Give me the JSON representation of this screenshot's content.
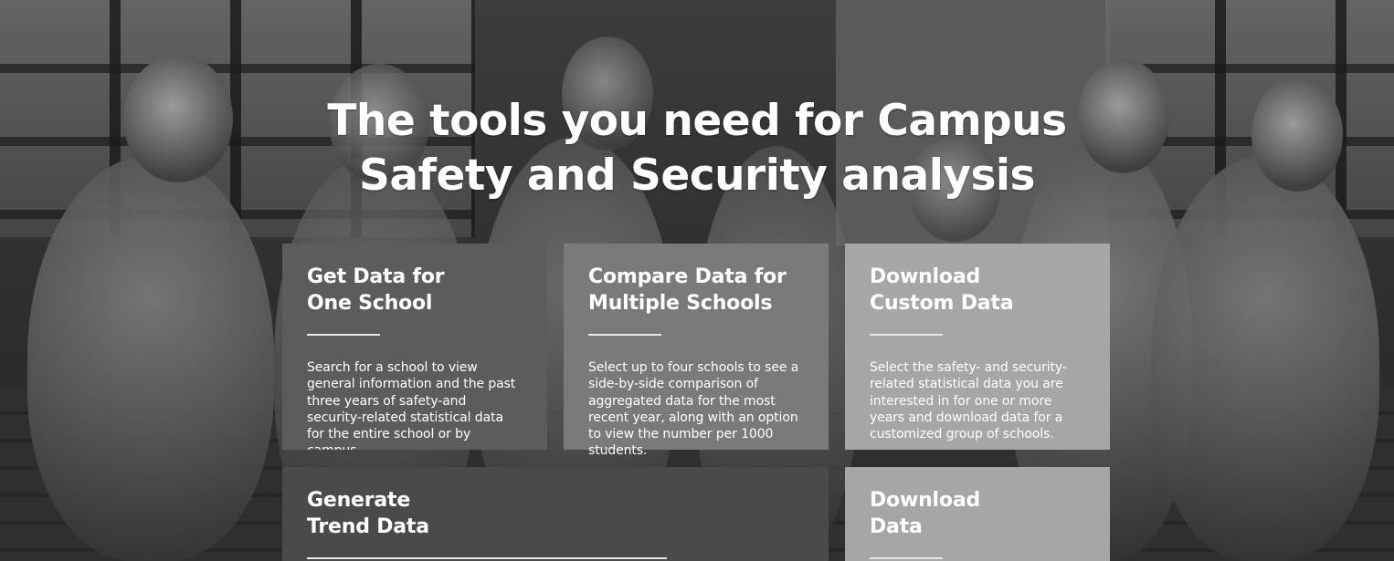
{
  "hero": {
    "title_line1": "The tools you need for Campus",
    "title_line2": "Safety and Security analysis"
  },
  "cards": [
    {
      "title_line1": "Get Data for",
      "title_line2": "One School",
      "description": "Search for a school to view general information and the past three years of safety-and security-related statistical data for the entire school or by campus."
    },
    {
      "title_line1": "Compare Data for",
      "title_line2": "Multiple Schools",
      "description": "Select up to four schools to see a side-by-side comparison of aggregated data for the most recent year, along with an option to view the number per 1000 students."
    },
    {
      "title_line1": "Download",
      "title_line2": "Custom Data",
      "description": "Select the safety- and security-related statistical data you are interested in for one or more years and download data for a customized group of schools."
    },
    {
      "title_line1": "Generate",
      "title_line2": "Trend Data"
    },
    {
      "title_line1": "Download",
      "title_line2": "Data"
    }
  ],
  "colors": {
    "card_dark": "#5c5c5c",
    "card_mid": "#7a7a7a",
    "card_light": "#a6a6a6",
    "card_darker": "#4a4a4a",
    "text": "#ffffff"
  }
}
